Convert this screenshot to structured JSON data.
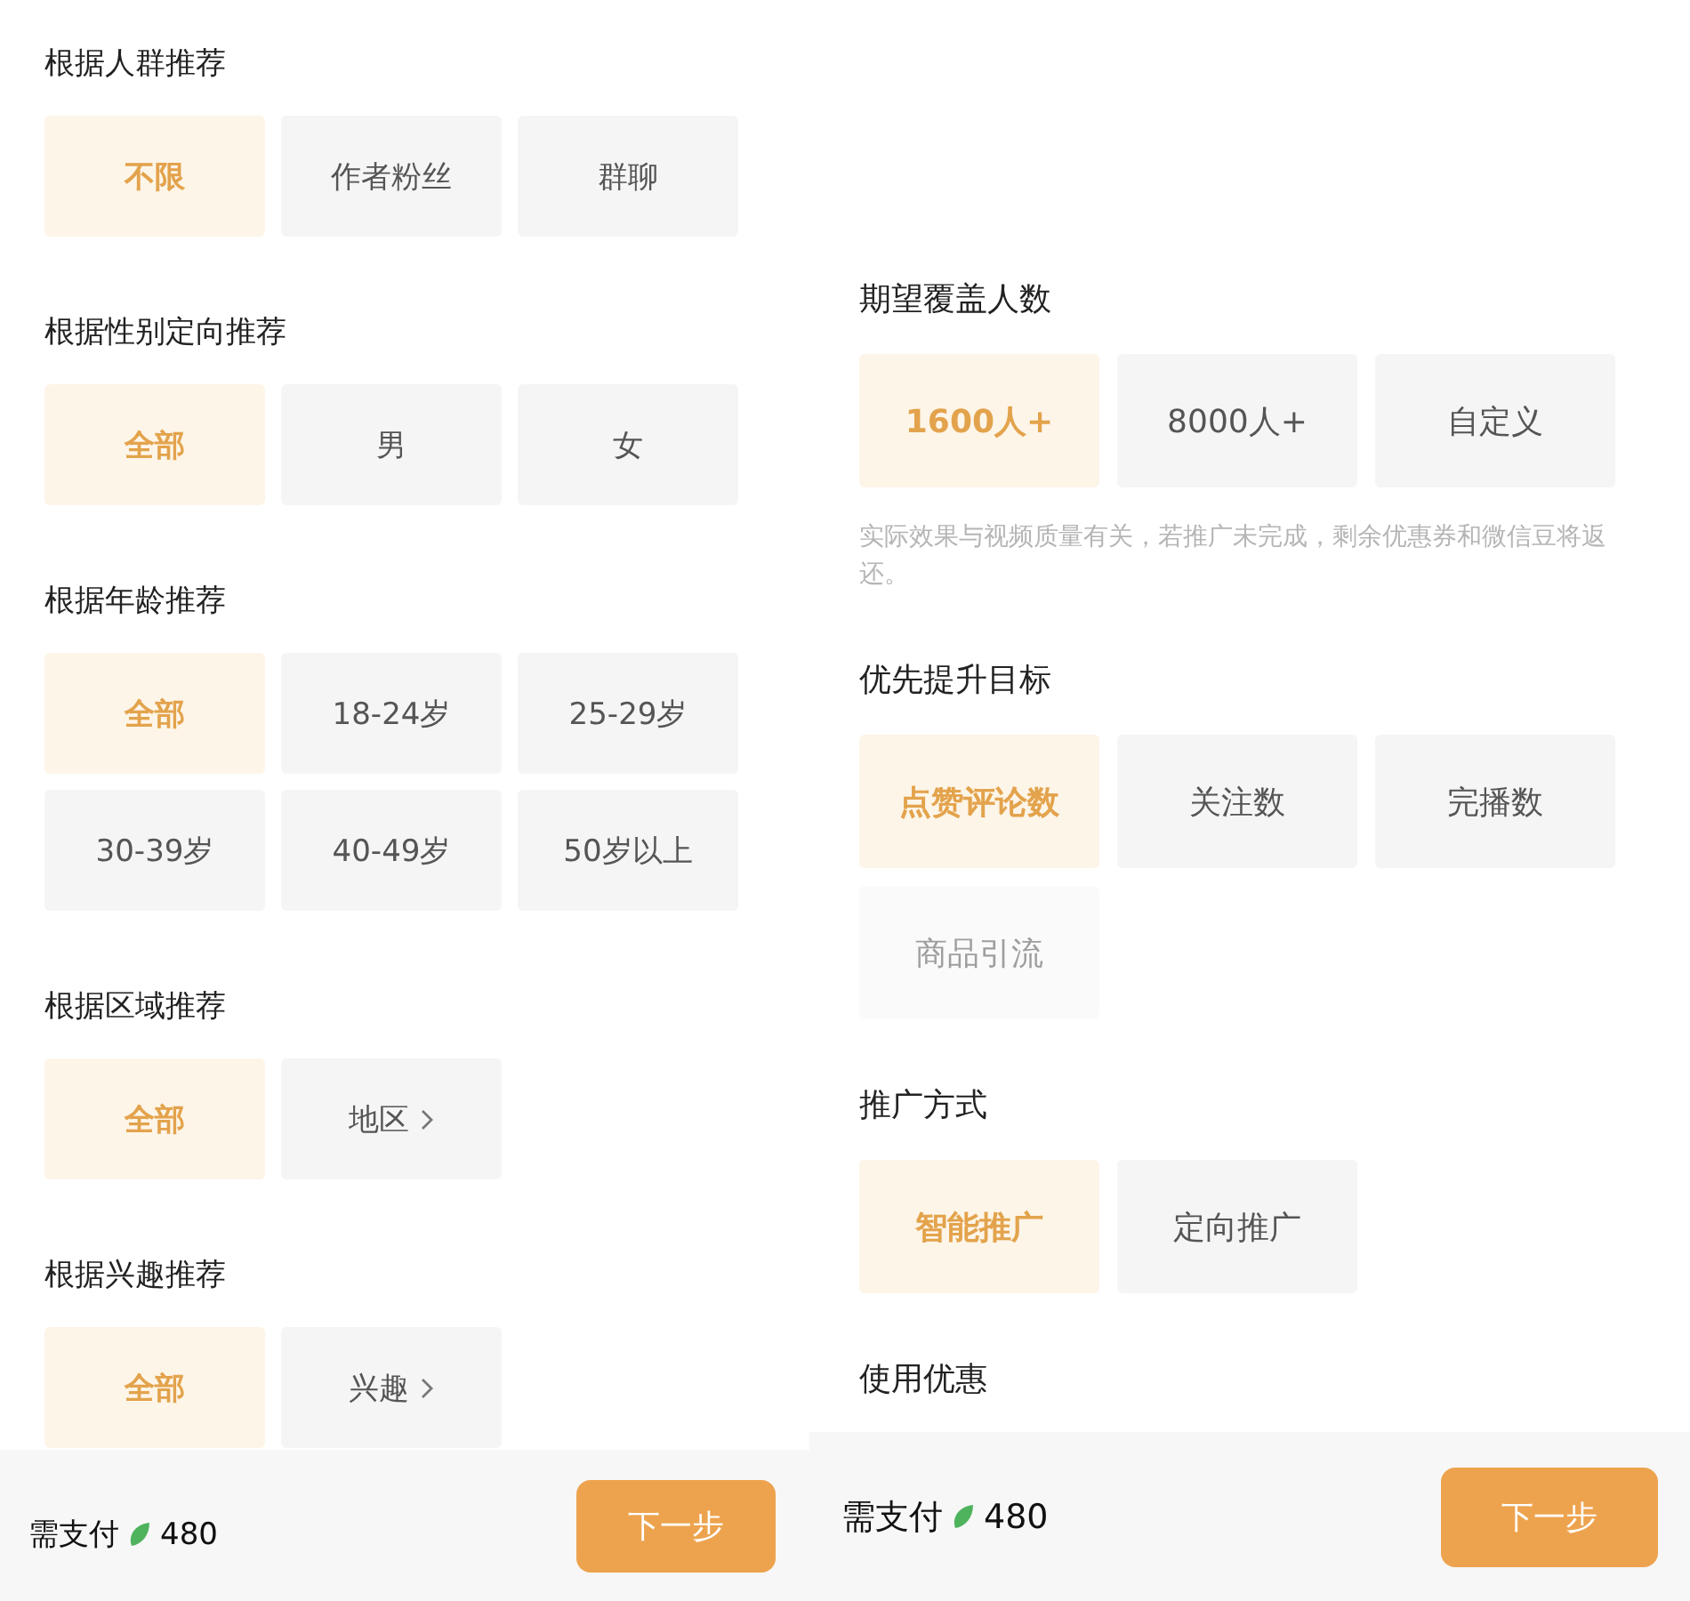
{
  "left_panel": {
    "sections": [
      {
        "title": "根据人群推荐",
        "options": [
          {
            "label": "不限",
            "selected": true
          },
          {
            "label": "作者粉丝",
            "selected": false
          },
          {
            "label": "群聊",
            "selected": false
          }
        ]
      },
      {
        "title": "根据性别定向推荐",
        "options": [
          {
            "label": "全部",
            "selected": true
          },
          {
            "label": "男",
            "selected": false
          },
          {
            "label": "女",
            "selected": false
          }
        ]
      },
      {
        "title": "根据年龄推荐",
        "options": [
          {
            "label": "全部",
            "selected": true
          },
          {
            "label": "18-24岁",
            "selected": false
          },
          {
            "label": "25-29岁",
            "selected": false
          },
          {
            "label": "30-39岁",
            "selected": false
          },
          {
            "label": "40-49岁",
            "selected": false
          },
          {
            "label": "50岁以上",
            "selected": false
          }
        ]
      },
      {
        "title": "根据区域推荐",
        "options": [
          {
            "label": "全部",
            "selected": true
          },
          {
            "label": "地区",
            "selected": false,
            "chevron": true
          }
        ]
      },
      {
        "title": "根据兴趣推荐",
        "options": [
          {
            "label": "全部",
            "selected": true
          },
          {
            "label": "兴趣",
            "selected": false,
            "chevron": true
          }
        ]
      }
    ],
    "footer": {
      "label": "需支付",
      "amount": "480",
      "button": "下一步"
    }
  },
  "right_panel": {
    "sections": [
      {
        "title": "期望覆盖人数",
        "options": [
          {
            "label": "1600人+",
            "selected": true
          },
          {
            "label": "8000人+",
            "selected": false
          },
          {
            "label": "自定义",
            "selected": false
          }
        ],
        "note": "实际效果与视频质量有关，若推广未完成，剩余优惠券和微信豆将返还。"
      },
      {
        "title": "优先提升目标",
        "options": [
          {
            "label": "点赞评论数",
            "selected": true
          },
          {
            "label": "关注数",
            "selected": false
          },
          {
            "label": "完播数",
            "selected": false
          },
          {
            "label": "商品引流",
            "selected": false,
            "disabled": true
          }
        ]
      },
      {
        "title": "推广方式",
        "options": [
          {
            "label": "智能推广",
            "selected": true
          },
          {
            "label": "定向推广",
            "selected": false
          }
        ]
      },
      {
        "title": "使用优惠"
      }
    ],
    "footer": {
      "label": "需支付",
      "amount": "480",
      "button": "下一步"
    }
  }
}
